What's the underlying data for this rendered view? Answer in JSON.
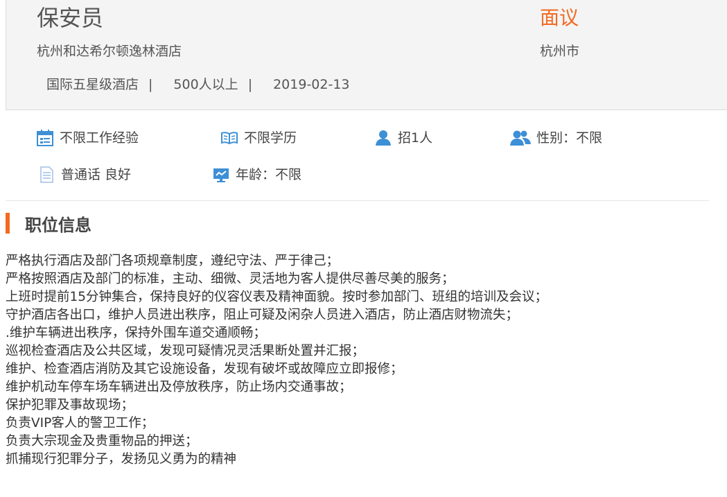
{
  "job": {
    "title": "保安员",
    "salary": "面议",
    "company": "杭州和达希尔顿逸林酒店",
    "location": "杭州市",
    "meta": [
      "国际五星级酒店",
      "500人以上",
      "2019-02-13"
    ],
    "meta_separator": "|"
  },
  "requirements": [
    {
      "icon": "calendar-icon",
      "label": "不限工作经验"
    },
    {
      "icon": "book-icon",
      "label": "不限学历"
    },
    {
      "icon": "person-icon",
      "label": "招1人"
    },
    {
      "icon": "people-icon",
      "label": "性别：不限"
    },
    {
      "icon": "document-icon",
      "label": "普通话 良好"
    },
    {
      "icon": "monitor-icon",
      "label": "年龄：不限"
    }
  ],
  "section": {
    "title": "职位信息"
  },
  "description": [
    " 严格执行酒店及部门各项规章制度，遵纪守法、严于律己；",
    "严格按照酒店及部门的标准，主动、细微、灵活地为客人提供尽善尽美的服务；",
    "上班时提前15分钟集合，保持良好的仪容仪表及精神面貌。按时参加部门、班组的培训及会议；",
    "守护酒店各出口，维护人员进出秩序，阻止可疑及闲杂人员进入酒店，防止酒店财物流失；",
    ".维护车辆进出秩序，保持外围车道交通顺畅；",
    "巡视检查酒店及公共区域，发现可疑情况灵活果断处置并汇报；",
    "维护、检查酒店消防及其它设施设备，发现有破坏或故障应立即报修；",
    "维护机动车停车场车辆进出及停放秩序，防止场内交通事故；",
    "保护犯罪及事故现场；",
    "负责VIP客人的警卫工作；",
    "负责大宗现金及贵重物品的押送；",
    "抓捕现行犯罪分子，发扬见义勇为的精神"
  ],
  "colors": {
    "accent": "#f26b21",
    "icon_blue": "#3d8fd6",
    "header_bg": "#f4f4f4"
  }
}
